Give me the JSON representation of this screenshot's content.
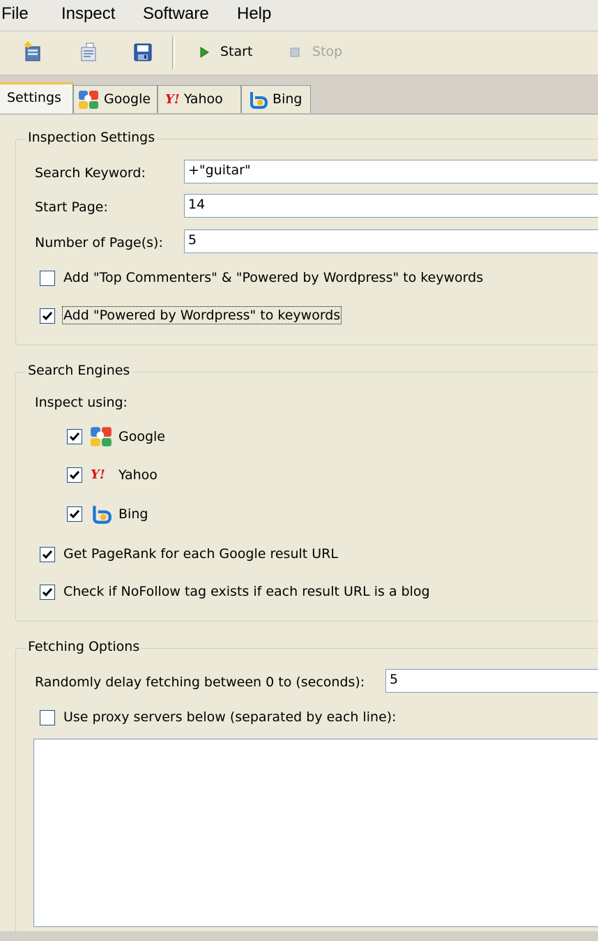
{
  "menu": [
    "File",
    "Inspect",
    "Software",
    "Help"
  ],
  "toolbar": {
    "new_icon": "new-document-icon",
    "open_icon": "open-icon",
    "save_icon": "save-floppy-icon",
    "start_label": "Start",
    "stop_label": "Stop"
  },
  "tabs": [
    {
      "label": "Settings",
      "icon": null,
      "active": true
    },
    {
      "label": "Google",
      "icon": "google-icon"
    },
    {
      "label": "Yahoo",
      "icon": "yahoo-icon"
    },
    {
      "label": "Bing",
      "icon": "bing-icon"
    }
  ],
  "inspection": {
    "legend": "Inspection Settings",
    "keyword_label": "Search Keyword:",
    "keyword_value": "+\"guitar\"",
    "start_page_label": "Start Page:",
    "start_page_value": "14",
    "num_pages_label": "Number of Page(s):",
    "num_pages_value": "5",
    "opt_top_commenters": {
      "label": "Add \"Top Commenters\" & \"Powered by Wordpress\" to keywords",
      "checked": false
    },
    "opt_powered_by": {
      "label": "Add \"Powered by Wordpress\" to keywords",
      "checked": true
    }
  },
  "engines": {
    "legend": "Search Engines",
    "inspect_label": "Inspect using:",
    "google": {
      "label": "Google",
      "checked": true
    },
    "yahoo": {
      "label": "Yahoo",
      "checked": true
    },
    "bing": {
      "label": "Bing",
      "checked": true
    },
    "pagerank": {
      "label": "Get PageRank for each Google result URL",
      "checked": true
    },
    "nofollow": {
      "label": "Check if NoFollow tag exists if each result URL is a blog",
      "checked": true
    }
  },
  "fetching": {
    "legend": "Fetching Options",
    "delay_label": "Randomly delay fetching between 0 to (seconds):",
    "delay_value": "5",
    "proxy_label": "Use proxy servers below (separated by each line):",
    "proxy_checked": false,
    "proxy_text": ""
  },
  "colors": {
    "tab_highlight": "#f5c04a",
    "panel_bg": "#ece9d8",
    "field_border": "#7f9db9"
  }
}
